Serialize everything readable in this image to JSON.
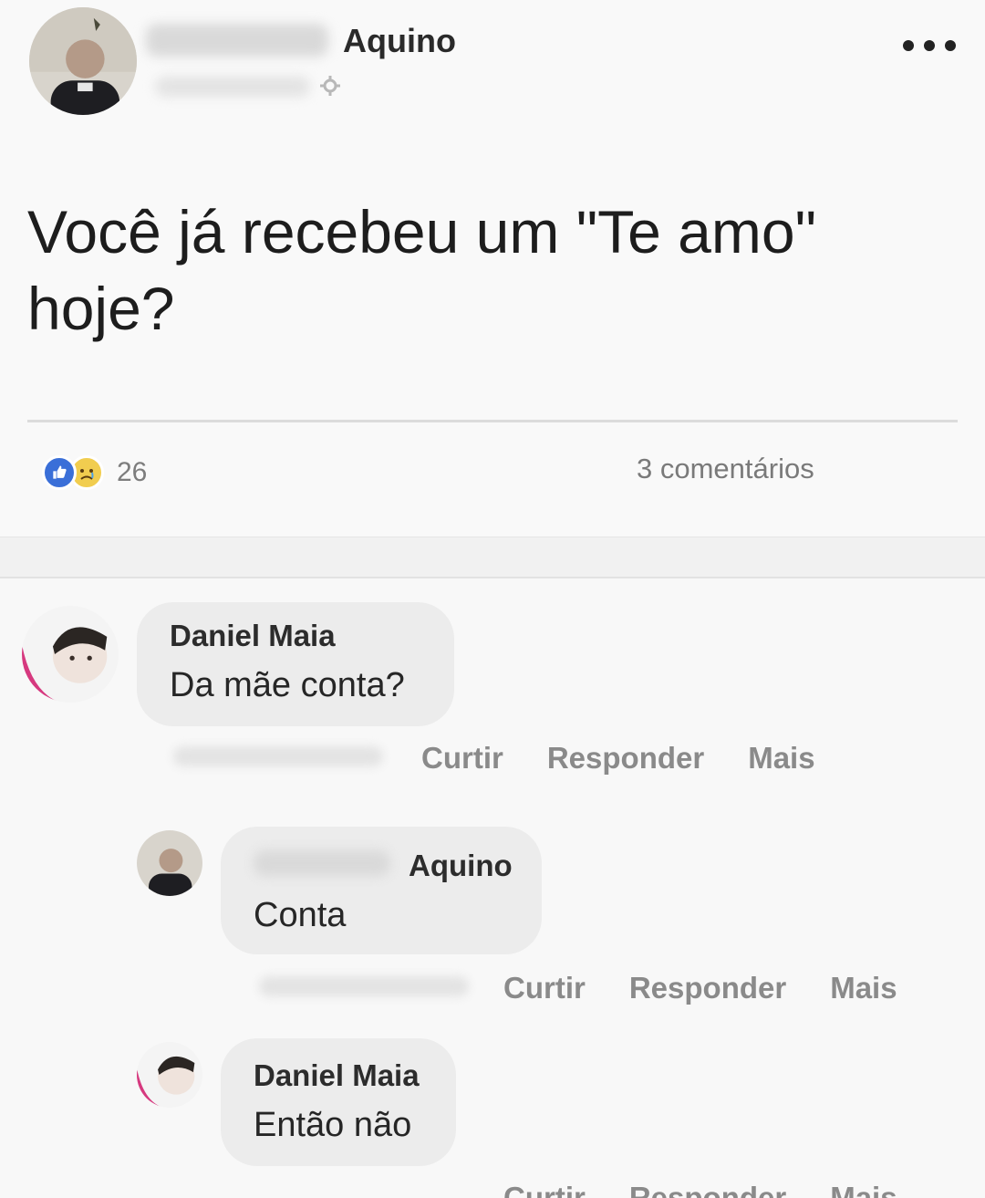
{
  "post": {
    "author_name_suffix": "Aquino",
    "text": "Você já recebeu um \"Te amo\" hoje?",
    "reactions_count": "26",
    "comments_label": "3 comentários"
  },
  "comments": [
    {
      "name": "Daniel Maia",
      "text": "Da mãe conta?",
      "actions": [
        "Curtir",
        "Responder",
        "Mais"
      ]
    },
    {
      "name": "Aquino",
      "text": "Conta",
      "actions": [
        "Curtir",
        "Responder",
        "Mais"
      ]
    },
    {
      "name": "Daniel Maia",
      "text": "Então não",
      "actions": [
        "Curtir",
        "Responder",
        "Mais"
      ]
    }
  ],
  "icons": {
    "like": "like-icon",
    "sad": "sad-reaction-icon",
    "gear": "gear-icon",
    "more": "more-horizontal-icon"
  },
  "colors": {
    "like_blue": "#3a6fd8",
    "bubble_gray": "#ececec",
    "action_gray": "#8a8a8a"
  }
}
